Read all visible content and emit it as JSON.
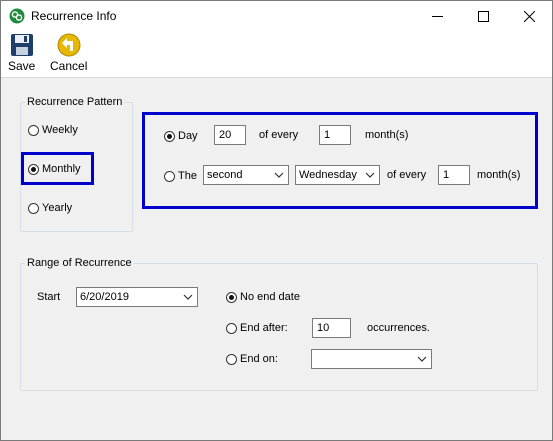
{
  "window": {
    "title": "Recurrence Info"
  },
  "toolbar": {
    "save_label": "Save",
    "cancel_label": "Cancel"
  },
  "pattern": {
    "group_title": "Recurrence Pattern",
    "weekly": "Weekly",
    "monthly": "Monthly",
    "yearly": "Yearly",
    "selected": "Monthly"
  },
  "monthly": {
    "day_label": "Day",
    "day_value": "20",
    "of_every_1": "of every",
    "every_months_1": "1",
    "months_1": "month(s)",
    "the_label": "The",
    "ordinal": "second",
    "weekday": "Wednesday",
    "of_every_2": "of every",
    "every_months_2": "1",
    "months_2": "month(s)"
  },
  "range": {
    "group_title": "Range of Recurrence",
    "start_label": "Start",
    "start_value": "6/20/2019",
    "no_end": "No end date",
    "end_after": "End after:",
    "occurrences_value": "10",
    "occurrences_label": "occurrences.",
    "end_on": "End on:",
    "end_on_value": ""
  },
  "colors": {
    "highlight": "#0000cc",
    "save_icon": "#1f3f6b",
    "cancel_icon": "#e6b800"
  }
}
